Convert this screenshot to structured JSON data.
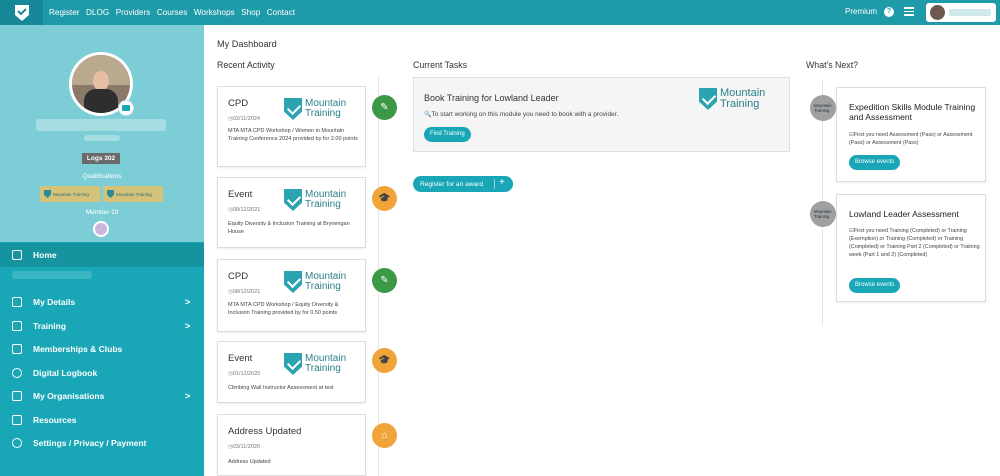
{
  "nav": {
    "items": [
      "Register",
      "DLOG",
      "Providers",
      "Courses",
      "Workshops",
      "Shop",
      "Contact"
    ],
    "premium_label": "Premium",
    "help_icon": "?"
  },
  "sidebar": {
    "logs_badge": "Logs 302",
    "qualifications_label": "Qualifications",
    "qual_badges": [
      "Mountain Training",
      "Mountain Training"
    ],
    "member_of_label": "Member Of",
    "items": [
      {
        "label": "Home",
        "icon": "home-icon"
      },
      {
        "label": "My Details",
        "icon": "user-icon",
        "chevron": ">"
      },
      {
        "label": "Training",
        "icon": "graduation-icon",
        "chevron": ">"
      },
      {
        "label": "Memberships & Clubs",
        "icon": "id-card-icon"
      },
      {
        "label": "Digital Logbook",
        "icon": "globe-icon"
      },
      {
        "label": "My Organisations",
        "icon": "flag-icon",
        "chevron": ">"
      },
      {
        "label": "Resources",
        "icon": "folder-icon"
      },
      {
        "label": "Settings / Privacy / Payment",
        "icon": "gear-icon"
      }
    ]
  },
  "main": {
    "title": "My Dashboard",
    "recent_activity_title": "Recent Activity",
    "current_tasks_title": "Current Tasks",
    "whats_next_title": "What's Next?",
    "logo_text_line1": "Mountain",
    "logo_text_line2": "Training",
    "activities": [
      {
        "type": "CPD",
        "date": "02/11/2024",
        "desc": "MTA MTA CPD Workshop / Women in Mountain Training Conference 2024 provided by for 2.00 points",
        "dot_icon": "pencil-icon"
      },
      {
        "type": "Event",
        "date": "08/12/2021",
        "desc": "Equity Diversity & Inclusion Training at Brynengan House",
        "dot_icon": "graduation-cap-icon"
      },
      {
        "type": "CPD",
        "date": "08/12/2021",
        "desc": "MTA MTA CPD Workshop / Equity Diversity & Inclusion Training provided by for 0.50 points",
        "dot_icon": "pencil-icon"
      },
      {
        "type": "Event",
        "date": "01/12/2020",
        "desc": "Climbing Wall Instructor Assessment at test",
        "dot_icon": "graduation-cap-icon"
      },
      {
        "type": "Address Updated",
        "date": "03/11/2020",
        "desc": "Address Updated",
        "dot_icon": "home-icon"
      }
    ],
    "task": {
      "title": "Book Training for Lowland Leader",
      "subtitle": "To start working on this module you need to book with a provider.",
      "button": "Find Training"
    },
    "register_button": "Register for an award",
    "register_plus": "+",
    "next": [
      {
        "title": "Expedition Skills Module Training and Assessment",
        "req": "First you need Assessment (Pass) or Assessment (Pass) or Assessment (Pass)",
        "button": "Browse events"
      },
      {
        "title": "Lowland Leader Assessment",
        "req": "First you need Training (Completed) or Training (Exemption) or Training (Completed) or Training (Completed) or Training Part 2 (Completed) or Training week (Part 1 and 2) (Completed)",
        "button": "Browse events"
      }
    ]
  },
  "colors": {
    "brand": "#1f9aa8",
    "sidebar": "#19a7b7",
    "green": "#3b9847",
    "orange": "#f0a43a"
  }
}
